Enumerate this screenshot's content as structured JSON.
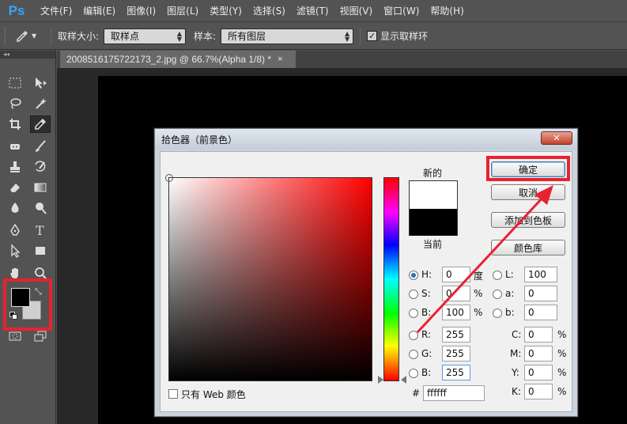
{
  "app": {
    "logo": "Ps"
  },
  "menu": [
    "文件(F)",
    "编辑(E)",
    "图像(I)",
    "图层(L)",
    "类型(Y)",
    "选择(S)",
    "滤镜(T)",
    "视图(V)",
    "窗口(W)",
    "帮助(H)"
  ],
  "options": {
    "sample_size_label": "取样大小:",
    "sample_size_value": "取样点",
    "sample_label": "样本:",
    "sample_value": "所有图层",
    "show_ring_label": "显示取样环",
    "show_ring_checked": true
  },
  "toolbox": {
    "collapse_glyph": "◂◂"
  },
  "document": {
    "tab_title": "2008516175722173_2.jpg @ 66.7%(Alpha 1/8) *",
    "close_glyph": "×"
  },
  "color_picker": {
    "title": "拾色器（前景色）",
    "close_glyph": "✕",
    "new_label": "新的",
    "current_label": "当前",
    "new_color": "#ffffff",
    "current_color": "#000000",
    "ok_label": "确定",
    "cancel_label": "取消",
    "add_swatch_label": "添加到色板",
    "libraries_label": "颜色库",
    "web_only_label": "只有 Web 颜色",
    "hex_label": "#",
    "hex_value": "ffffff",
    "h": {
      "label": "H:",
      "value": "0",
      "unit": "度"
    },
    "s": {
      "label": "S:",
      "value": "0",
      "unit": "%"
    },
    "b": {
      "label": "B:",
      "value": "100",
      "unit": "%"
    },
    "r": {
      "label": "R:",
      "value": "255"
    },
    "g": {
      "label": "G:",
      "value": "255"
    },
    "bl": {
      "label": "B:",
      "value": "255"
    },
    "lab_l": {
      "label": "L:",
      "value": "100"
    },
    "lab_a": {
      "label": "a:",
      "value": "0"
    },
    "lab_b": {
      "label": "b:",
      "value": "0"
    },
    "c": {
      "label": "C:",
      "value": "0",
      "unit": "%"
    },
    "m": {
      "label": "M:",
      "value": "0",
      "unit": "%"
    },
    "y": {
      "label": "Y:",
      "value": "0",
      "unit": "%"
    },
    "k": {
      "label": "K:",
      "value": "0",
      "unit": "%"
    }
  },
  "colors": {
    "annotation_red": "#e8222f",
    "ps_blue": "#31a8ff"
  }
}
